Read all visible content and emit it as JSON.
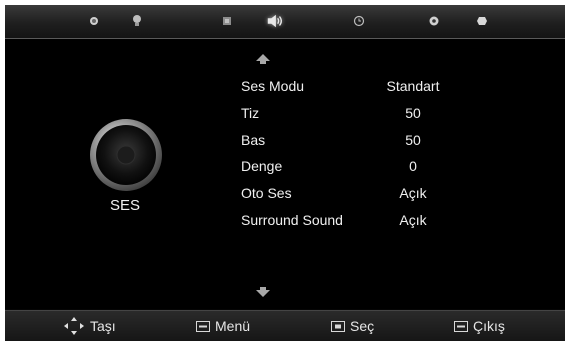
{
  "top_tabs": [
    {
      "icon": "picture-icon",
      "active": false
    },
    {
      "icon": "lightbulb-icon",
      "active": false
    },
    {
      "icon": "channel-icon",
      "active": false
    },
    {
      "icon": "speaker-icon",
      "active": true
    },
    {
      "icon": "clock-icon",
      "active": false
    },
    {
      "icon": "settings-icon",
      "active": false
    },
    {
      "icon": "source-icon",
      "active": false
    }
  ],
  "section": {
    "label": "SES",
    "icon": "speaker-icon"
  },
  "menu": {
    "items": [
      {
        "label": "Ses Modu",
        "value": "Standart"
      },
      {
        "label": "Tiz",
        "value": "50"
      },
      {
        "label": "Bas",
        "value": "50"
      },
      {
        "label": "Denge",
        "value": "0"
      },
      {
        "label": "Oto Ses",
        "value": "Açık"
      },
      {
        "label": "Surround Sound",
        "value": "Açık"
      }
    ]
  },
  "footer": {
    "move_label": "Taşı",
    "menu_label": "Menü",
    "select_label": "Seç",
    "exit_label": "Çıkış"
  },
  "colors": {
    "background": "#000000",
    "text": "#f0f0f0",
    "bar": "#1f1f1f"
  }
}
